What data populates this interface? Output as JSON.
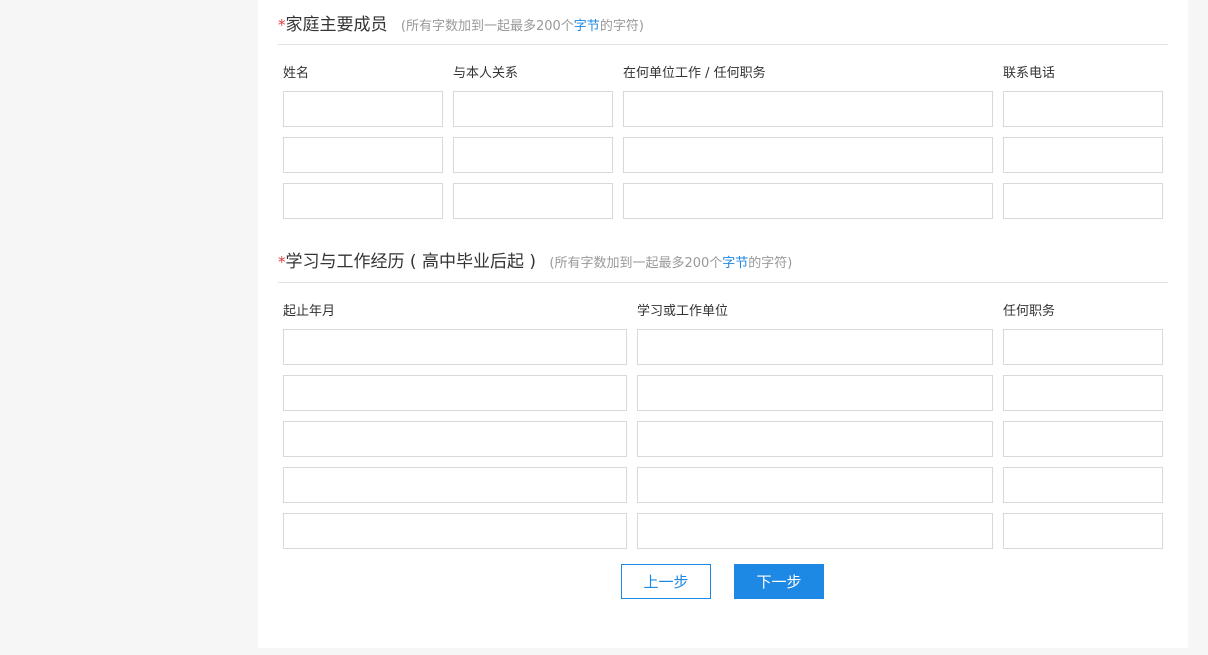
{
  "family": {
    "title": "家庭主要成员",
    "note_prefix": "(所有字数加到一起最多200个",
    "note_link": "字节",
    "note_suffix": "的字符)",
    "columns": {
      "name": "姓名",
      "relation": "与本人关系",
      "employer": "在何单位工作 / 任何职务",
      "phone": "联系电话"
    },
    "rows": 3
  },
  "history": {
    "title": "学习与工作经历 ( 高中毕业后起 )",
    "note_prefix": "(所有字数加到一起最多200个",
    "note_link": "字节",
    "note_suffix": "的字符)",
    "columns": {
      "period": "起止年月",
      "unit": "学习或工作单位",
      "position": "任何职务"
    },
    "rows": 5
  },
  "required_mark": "*",
  "buttons": {
    "prev": "上一步",
    "next": "下一步"
  },
  "colors": {
    "accent": "#1e88e5",
    "required": "#e4393c"
  }
}
